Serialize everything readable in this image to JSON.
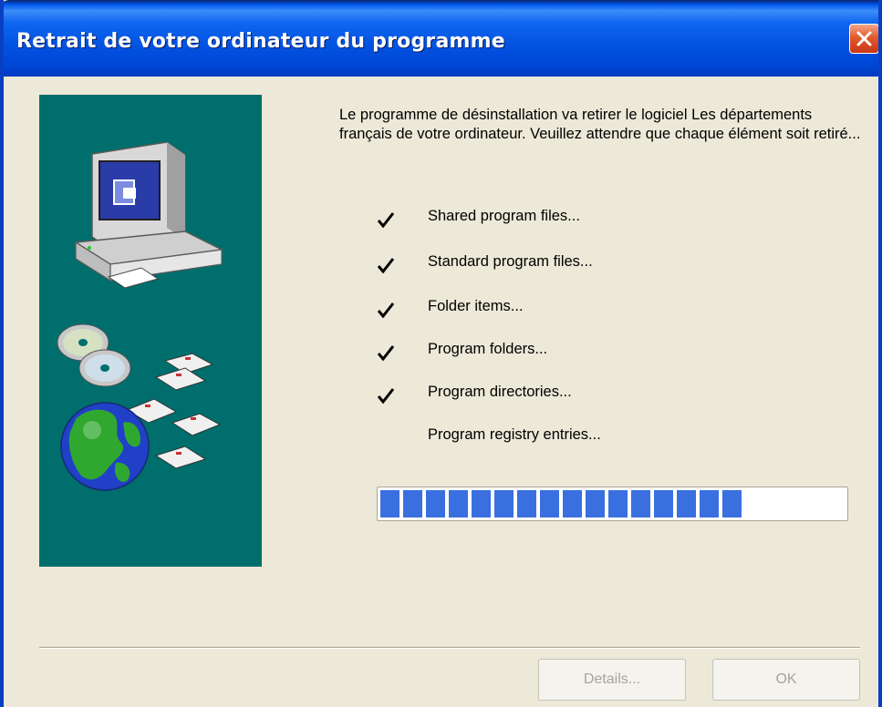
{
  "window": {
    "title": "Retrait de votre ordinateur du programme",
    "close_icon": "close-icon"
  },
  "colors": {
    "title_bar": "#0254e0",
    "art_panel": "#006e6c",
    "progress": "#3a6fe0",
    "close_button": "#e35a2b"
  },
  "intro_text": "Le programme de désinstallation va retirer le logiciel Les départements français de votre ordinateur. Veuillez attendre que chaque élément soit retiré...",
  "steps": [
    {
      "label": "Shared program files...",
      "done": true
    },
    {
      "label": "Standard program files...",
      "done": true
    },
    {
      "label": "Folder items...",
      "done": true
    },
    {
      "label": "Program folders...",
      "done": true
    },
    {
      "label": "Program directories...",
      "done": true
    },
    {
      "label": "Program registry entries...",
      "done": false
    }
  ],
  "progress": {
    "fraction": 0.8
  },
  "buttons": {
    "details": "Details...",
    "ok": "OK"
  }
}
